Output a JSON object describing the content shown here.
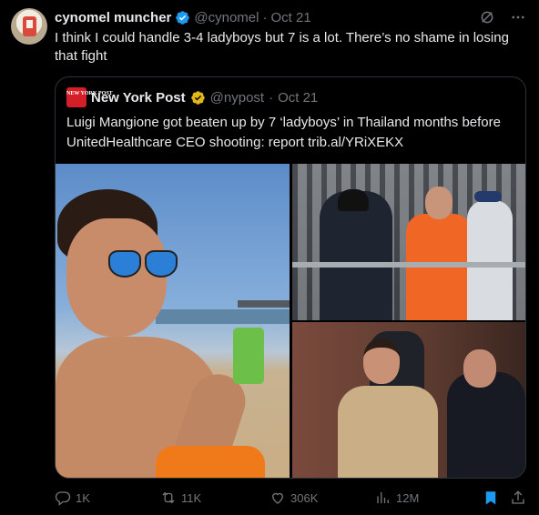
{
  "tweet": {
    "display_name": "cynomel muncher",
    "handle": "@cynomel",
    "separator": "·",
    "date": "Oct 21",
    "text": "I think I could handle 3-4 ladyboys but 7 is a lot. There’s no shame in losing that fight"
  },
  "quote": {
    "logo_text": "NEW YORK POST",
    "display_name": "New York Post",
    "handle": "@nypost",
    "separator": "·",
    "date": "Oct 21",
    "text": "Luigi Mangione got beaten up by 7 ‘ladyboys’ in Thailand months before UnitedHealthcare CEO shooting: report trib.al/YRiXEKX",
    "photos": [
      "man-with-sunglasses-beach-photo",
      "police-escort-orange-jumpsuit-photo",
      "courtroom-tan-jumpsuit-photo"
    ]
  },
  "actions": {
    "replies": "1K",
    "reposts": "11K",
    "likes": "306K",
    "views": "12M"
  },
  "colors": {
    "background": "#000000",
    "text": "#e7e9ea",
    "muted": "#71767b",
    "verified_blue": "#1d9bf0",
    "verified_gold": "#e2b719",
    "bookmark_active": "#1d9bf0",
    "border": "#2f3336"
  },
  "icons": [
    "verified-badge-icon",
    "grok-icon",
    "more-icon",
    "gold-verified-badge-icon",
    "reply-icon",
    "repost-icon",
    "like-icon",
    "views-icon",
    "bookmark-icon",
    "share-icon"
  ]
}
